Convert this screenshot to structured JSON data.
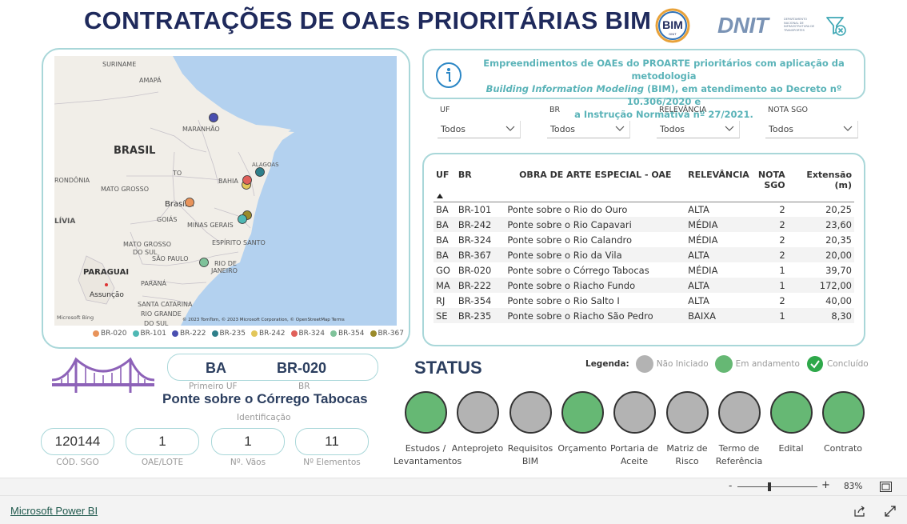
{
  "header": {
    "title": "CONTRATAÇÕES DE OAEs PRIORITÁRIAS BIM",
    "bim_logo_text": "BIM",
    "bim_logo_sub": "DNIT",
    "dnit_logo_text": "DNIT",
    "dnit_logo_sub": "DEPARTAMENTO NACIONAL DE INFRAESTRUTURA DE TRANSPORTES",
    "filter_icon": "filter-clear-icon"
  },
  "map": {
    "labels": [
      "SURINAME",
      "AMAPÁ",
      "MARANHÃO",
      "BRASIL",
      "TO",
      "BAHIA",
      "ALAGOAS",
      "RONDÔNIA",
      "MATO GROSSO",
      "Brasília",
      "GOIÁS",
      "MINAS GERAIS",
      "ESPÍRITO SANTO",
      "MATO GROSSO DO SUL",
      "SÃO PAULO",
      "RIO DE JANEIRO",
      "PARAGUAI",
      "PARANÁ",
      "Assunção",
      "SANTA CATARINA",
      "RIO GRANDE DO SUL",
      "LÍVIA"
    ],
    "attribution": "© 2023 TomTom, © 2023 Microsoft Corporation, © OpenStreetMap  Terms",
    "bing": "Microsoft Bing",
    "legend": [
      {
        "label": "BR-020",
        "color": "#e8935a"
      },
      {
        "label": "BR-101",
        "color": "#4fb8b4"
      },
      {
        "label": "BR-222",
        "color": "#4a4fb0"
      },
      {
        "label": "BR-235",
        "color": "#2f7f8a"
      },
      {
        "label": "BR-242",
        "color": "#e2c65a"
      },
      {
        "label": "BR-324",
        "color": "#e0605a"
      },
      {
        "label": "BR-354",
        "color": "#7fc29a"
      },
      {
        "label": "BR-367",
        "color": "#9a8a2a"
      }
    ]
  },
  "info": {
    "line1": "Empreendimentos de OAEs do PROARTE prioritários com aplicação da metodologia",
    "line2_italic": "Building Information Modeling",
    "line2_rest": " (BIM), em atendimento ao Decreto nº 10.306/2020 e",
    "line3": "a Instrução Normativa nº 27/2021."
  },
  "filters": [
    {
      "label": "UF",
      "value": "Todos"
    },
    {
      "label": "BR",
      "value": "Todos"
    },
    {
      "label": "RELEVÂNCIA",
      "value": "Todos"
    },
    {
      "label": "NOTA SGO",
      "value": "Todos"
    }
  ],
  "table": {
    "headers": {
      "uf": "UF",
      "br": "BR",
      "oae": "OBRA DE ARTE ESPECIAL - OAE",
      "rel": "RELEVÂNCIA",
      "nota": "NOTA SGO",
      "ext": "Extensão (m)"
    },
    "rows": [
      {
        "uf": "BA",
        "br": "BR-101",
        "oae": "Ponte sobre o Rio do Ouro",
        "rel": "ALTA",
        "nota": "2",
        "ext": "20,25"
      },
      {
        "uf": "BA",
        "br": "BR-242",
        "oae": "Ponte sobre o Rio Capavari",
        "rel": "MÉDIA",
        "nota": "2",
        "ext": "23,60"
      },
      {
        "uf": "BA",
        "br": "BR-324",
        "oae": "Ponte sobre o Rio Calandro",
        "rel": "MÉDIA",
        "nota": "2",
        "ext": "20,35"
      },
      {
        "uf": "BA",
        "br": "BR-367",
        "oae": "Ponte sobre o Rio da Vila",
        "rel": "ALTA",
        "nota": "2",
        "ext": "20,00"
      },
      {
        "uf": "GO",
        "br": "BR-020",
        "oae": "Ponte sobre o Córrego Tabocas",
        "rel": "MÉDIA",
        "nota": "1",
        "ext": "39,70"
      },
      {
        "uf": "MA",
        "br": "BR-222",
        "oae": "Ponte sobre o Riacho Fundo",
        "rel": "ALTA",
        "nota": "1",
        "ext": "172,00"
      },
      {
        "uf": "RJ",
        "br": "BR-354",
        "oae": "Ponte sobre o Rio Salto I",
        "rel": "ALTA",
        "nota": "2",
        "ext": "40,00"
      },
      {
        "uf": "SE",
        "br": "BR-235",
        "oae": "Ponte sobre o Riacho São Pedro",
        "rel": "BAIXA",
        "nota": "1",
        "ext": "8,30"
      }
    ]
  },
  "detail": {
    "uf_value": "BA",
    "br_value": "BR-020",
    "uf_label": "Primeiro UF",
    "br_label": "BR",
    "obra": "Ponte sobre o Córrego Tabocas",
    "obra_label": "Identificação",
    "kpis": [
      {
        "value": "120144",
        "label": "CÓD. SGO"
      },
      {
        "value": "1",
        "label": "OAE/LOTE"
      },
      {
        "value": "1",
        "label": "Nº. Vãos"
      },
      {
        "value": "11",
        "label": "Nº Elementos"
      }
    ]
  },
  "status": {
    "title": "STATUS",
    "legend_title": "Legenda:",
    "legend": [
      {
        "label": "Não Iniciado",
        "color": "#b3b3b3"
      },
      {
        "label": "Em andamento",
        "color": "#66b874"
      },
      {
        "label": "Concluído",
        "color": "#2ea84a"
      }
    ],
    "steps": [
      {
        "label": "Estudos / Levantamentos",
        "state": "done"
      },
      {
        "label": "Anteprojeto",
        "state": "todo"
      },
      {
        "label": "Requisitos BIM",
        "state": "todo"
      },
      {
        "label": "Orçamento",
        "state": "done"
      },
      {
        "label": "Portaria de Aceite",
        "state": "todo"
      },
      {
        "label": "Matriz de Risco",
        "state": "todo"
      },
      {
        "label": "Termo de Referência",
        "state": "todo"
      },
      {
        "label": "Edital",
        "state": "done"
      },
      {
        "label": "Contrato",
        "state": "done"
      }
    ]
  },
  "zoom": {
    "minus": "-",
    "plus": "+",
    "value": "83%"
  },
  "footer": {
    "link": "Microsoft Power BI"
  }
}
